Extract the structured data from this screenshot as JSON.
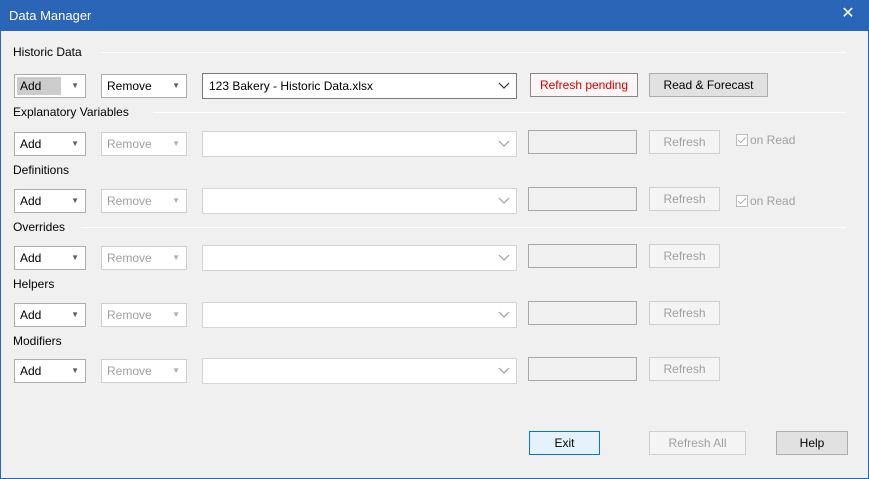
{
  "window": {
    "title": "Data Manager",
    "close_glyph": "✕"
  },
  "sections": {
    "historic": "Historic Data",
    "explanatory": "Explanatory Variables",
    "definitions": "Definitions",
    "overrides": "Overrides",
    "helpers": "Helpers",
    "modifiers": "Modifiers"
  },
  "common": {
    "add_label": "Add",
    "remove_label": "Remove",
    "refresh_label": "Refresh",
    "on_read_label": "on Read",
    "dropdown_arrow": "▼"
  },
  "historic_row": {
    "file": "123 Bakery - Historic Data.xlsx",
    "status": "Refresh pending",
    "read_forecast_label": "Read & Forecast"
  },
  "footer": {
    "exit_label": "Exit",
    "refresh_all_label": "Refresh All",
    "help_label": "Help"
  },
  "colors": {
    "titlebar": "#2b65b8",
    "pending_text": "#d40000",
    "window_bg": "#f0f0f0"
  }
}
